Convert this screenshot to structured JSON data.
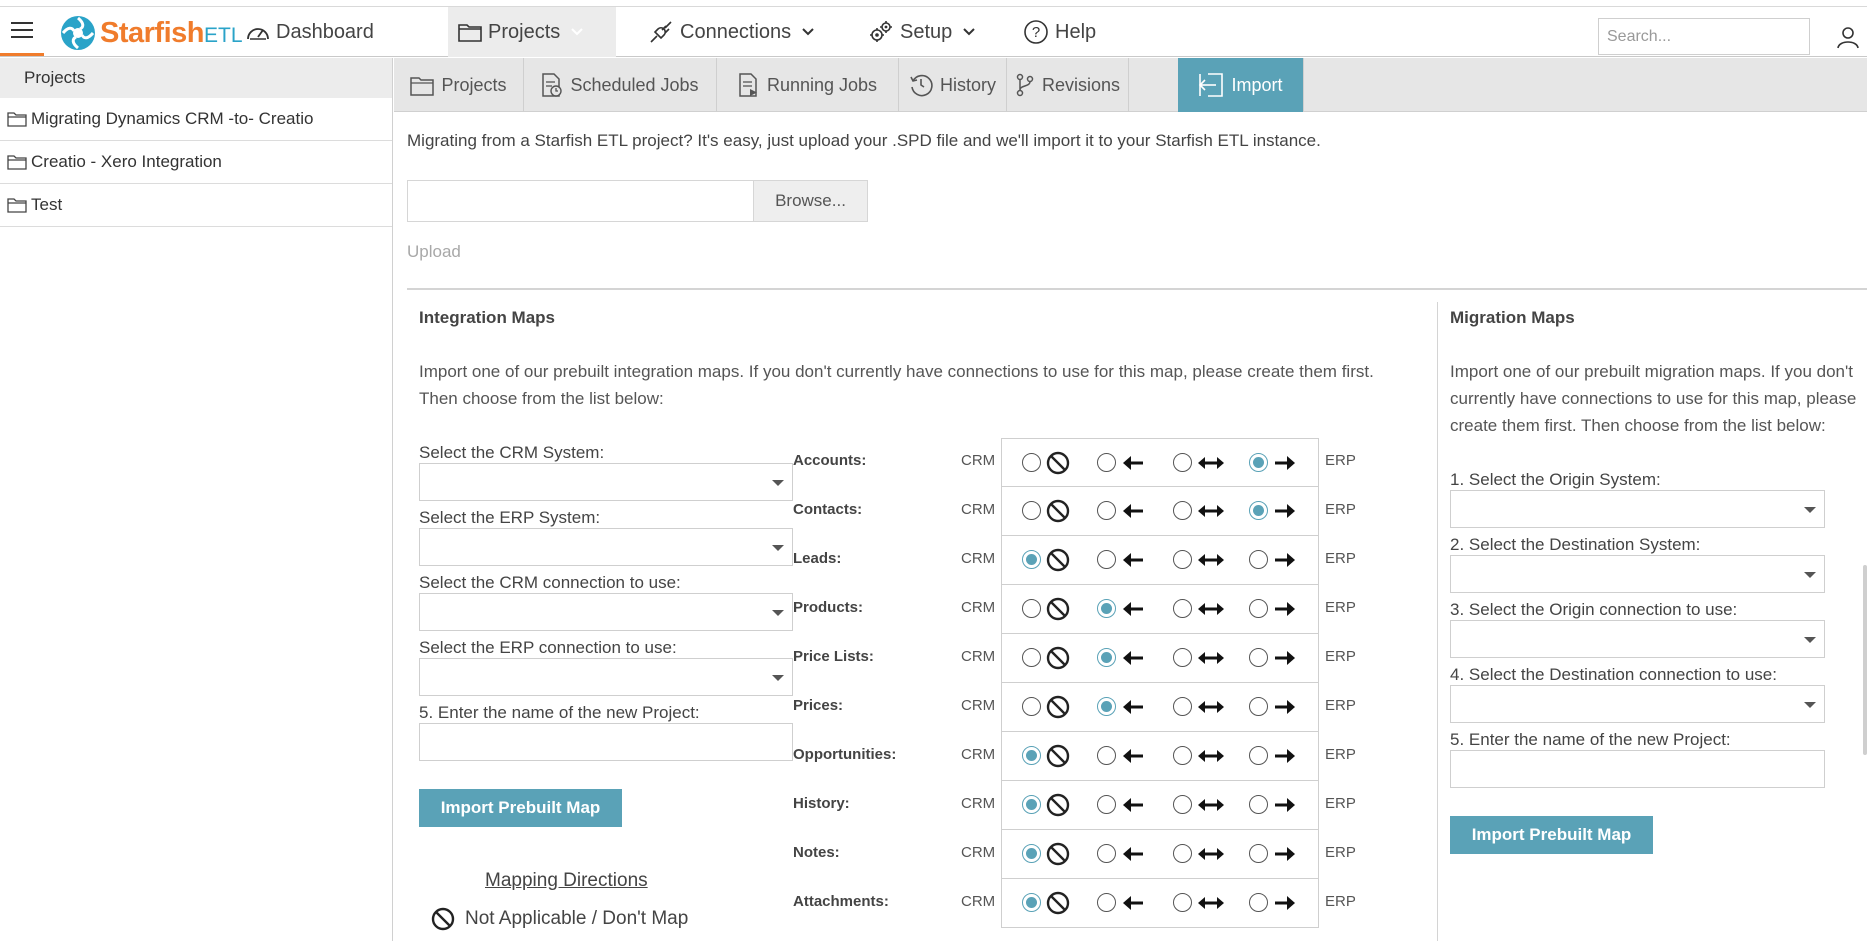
{
  "nav": {
    "logo_main": "Starfish",
    "logo_suffix": "ETL",
    "items": [
      {
        "label": "Dashboard"
      },
      {
        "label": "Projects"
      },
      {
        "label": "Connections"
      },
      {
        "label": "Setup"
      },
      {
        "label": "Help"
      }
    ],
    "search_placeholder": "Search..."
  },
  "sidebar": {
    "header": "Projects",
    "items": [
      {
        "label": "Migrating Dynamics CRM -to- Creatio"
      },
      {
        "label": "Creatio - Xero Integration"
      },
      {
        "label": "Test"
      }
    ]
  },
  "tabs": [
    {
      "label": "Projects"
    },
    {
      "label": "Scheduled Jobs"
    },
    {
      "label": "Running Jobs"
    },
    {
      "label": "History"
    },
    {
      "label": "Revisions"
    },
    {
      "label": "Import"
    }
  ],
  "import": {
    "intro": "Migrating from a Starfish ETL project? It's easy, just upload your .SPD file and we'll import it to your Starfish ETL instance.",
    "browse_label": "Browse...",
    "upload_label": "Upload"
  },
  "integration": {
    "title": "Integration Maps",
    "description_line1": "Import one of our prebuilt integration maps. If you don't currently have connections to use for this map, please create them first.",
    "description_line2": "Then choose from the list below:",
    "crm_system_label": "Select the CRM System:",
    "erp_system_label": "Select the ERP System:",
    "crm_connection_label": "Select the CRM connection to use:",
    "erp_connection_label": "Select the ERP connection to use:",
    "project_name_label": "5. Enter the name of the new Project:",
    "button_label": "Import Prebuilt Map",
    "left_system": "CRM",
    "right_system": "ERP",
    "mappings": [
      {
        "entity": "Accounts:",
        "selected": "right"
      },
      {
        "entity": "Contacts:",
        "selected": "right"
      },
      {
        "entity": "Leads:",
        "selected": "none"
      },
      {
        "entity": "Products:",
        "selected": "left"
      },
      {
        "entity": "Price Lists:",
        "selected": "left"
      },
      {
        "entity": "Prices:",
        "selected": "left"
      },
      {
        "entity": "Opportunities:",
        "selected": "none"
      },
      {
        "entity": "History:",
        "selected": "none"
      },
      {
        "entity": "Notes:",
        "selected": "none"
      },
      {
        "entity": "Attachments:",
        "selected": "none"
      }
    ],
    "legend_title": "Mapping Directions",
    "legend_none": "Not Applicable / Don't Map"
  },
  "migration": {
    "title": "Migration Maps",
    "description_line1": "Import one of our prebuilt migration maps. If you don't",
    "description_line2": "currently have connections to use for this map, please",
    "description_line3": "create them first. Then choose from the list below:",
    "origin_system_label": "1. Select the Origin System:",
    "destination_system_label": "2. Select the Destination System:",
    "origin_connection_label": "3. Select the Origin connection to use:",
    "destination_connection_label": "4. Select the Destination connection to use:",
    "project_name_label": "5. Enter the name of the new Project:",
    "button_label": "Import Prebuilt Map"
  },
  "colors": {
    "accent": "#5aa2b7",
    "brand_orange": "#f07c2c",
    "brand_blue": "#2aa3c8"
  }
}
